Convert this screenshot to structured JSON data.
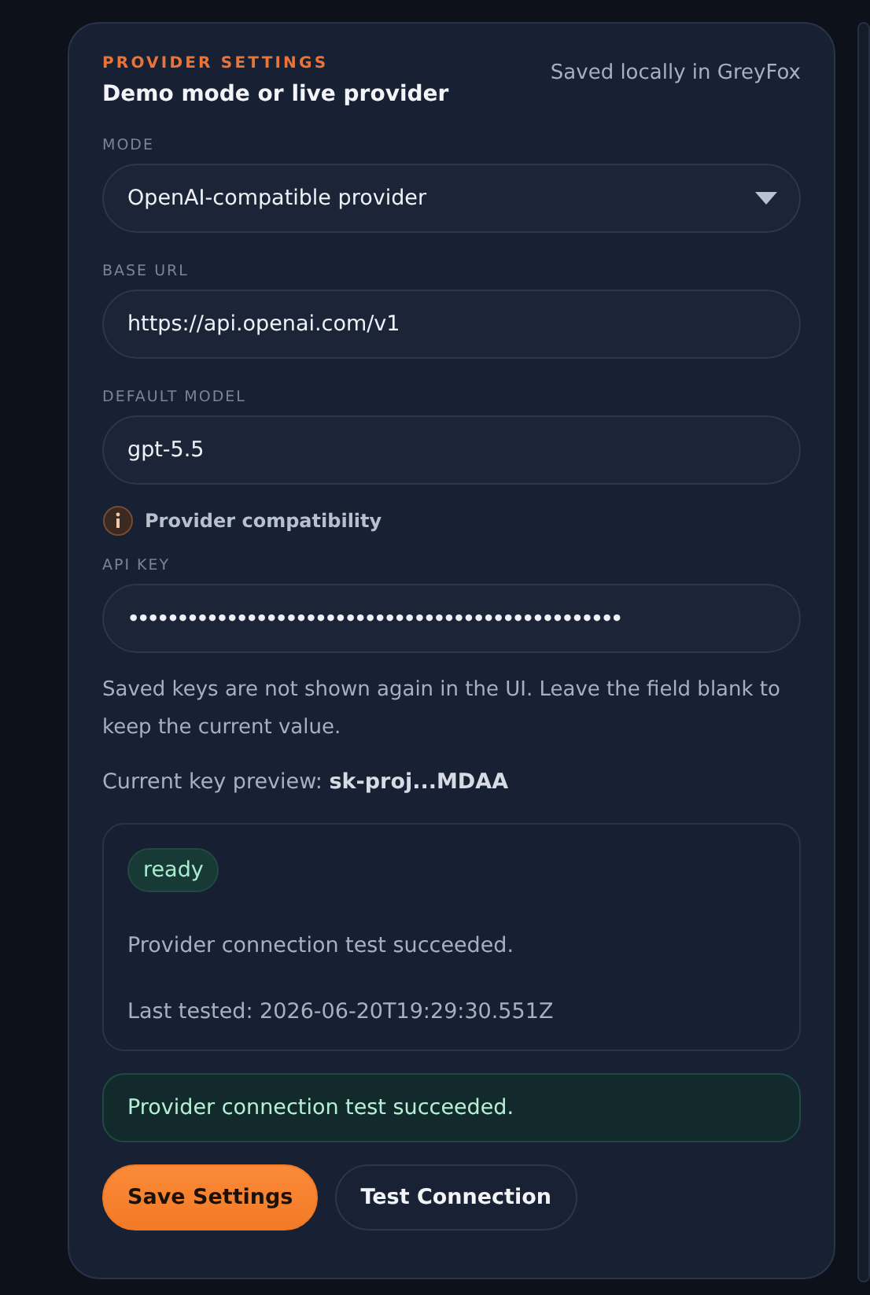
{
  "panel": {
    "eyebrow": "PROVIDER SETTINGS",
    "title": "Demo mode or live provider",
    "storage_note": "Saved locally in GreyFox"
  },
  "fields": [
    {
      "kind": "select",
      "label": "MODE",
      "value": "OpenAI-compatible provider"
    },
    {
      "kind": "text",
      "label": "BASE URL",
      "value": "https://api.openai.com/v1"
    },
    {
      "kind": "text",
      "label": "DEFAULT MODEL",
      "value": "gpt-5.5"
    },
    {
      "kind": "info",
      "label": "Provider compatibility"
    },
    {
      "kind": "password",
      "label": "API KEY",
      "value": "••••••••••••••••••••••••••••••••••••••••••••••••••"
    }
  ],
  "help_text": "Saved keys are not shown again in the UI. Leave the field blank to keep the current value.",
  "key_preview": "Current key preview: **sk-proj...MDAA**",
  "status": {
    "badge": "ready",
    "message": "Provider connection test succeeded.",
    "last_tested": "Last tested: 2026-06-20T19:29:30.551Z"
  },
  "alert": {
    "kind": "success",
    "text": "Provider connection test succeeded."
  },
  "buttons": [
    {
      "label": "Save Settings",
      "primary": true
    },
    {
      "label": "Test Connection",
      "primary": false
    }
  ]
}
